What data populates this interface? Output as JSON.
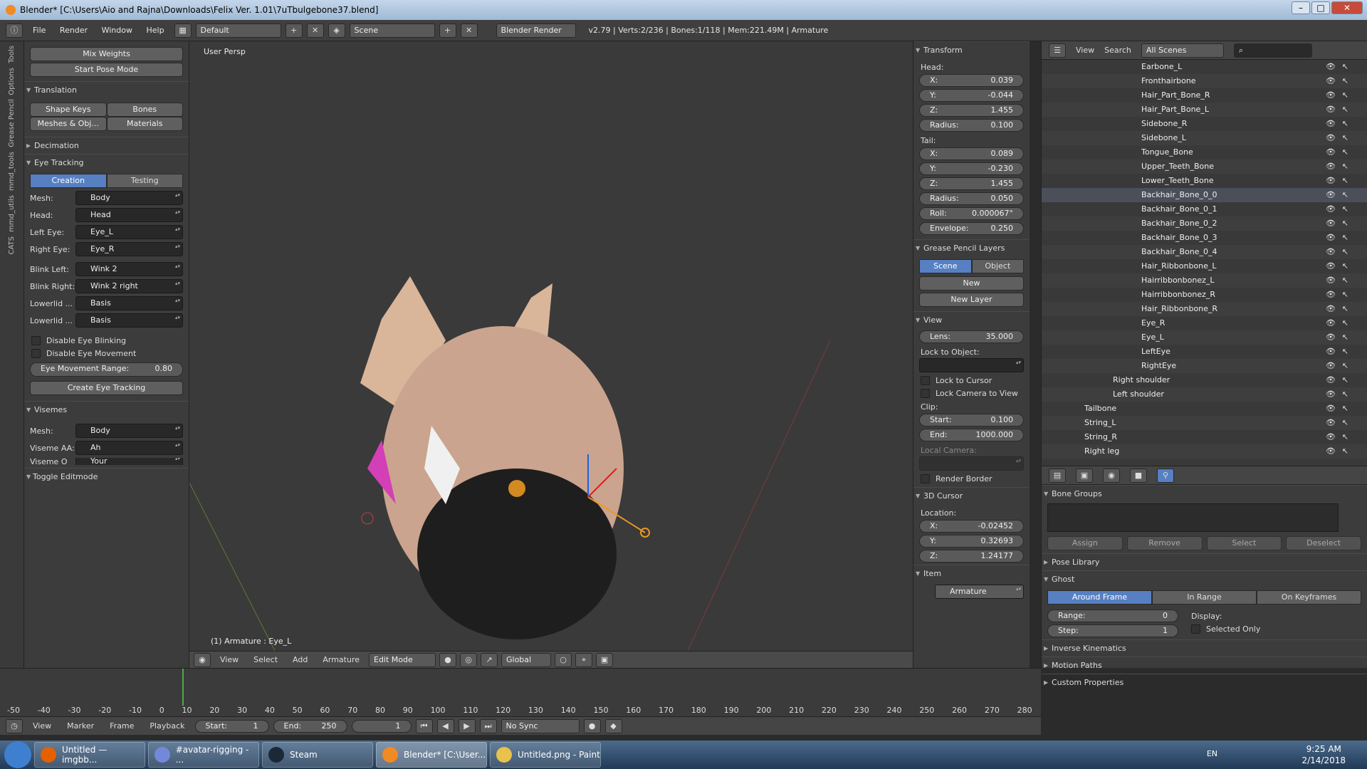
{
  "window": {
    "title": "Blender* [C:\\Users\\Aio and Rajna\\Downloads\\Felix Ver. 1.01\\7uTbulgebone37.blend]"
  },
  "topbar": {
    "menus": [
      "File",
      "Render",
      "Window",
      "Help"
    ],
    "layout": "Default",
    "scene": "Scene",
    "engine": "Blender Render",
    "stats": "v2.79 | Verts:2/236 | Bones:1/118 | Mem:221.49M | Armature"
  },
  "lefttabs": [
    "Tools",
    "Options",
    "Grease Pencil",
    "mmd_tools",
    "mmd_utils",
    "CATS"
  ],
  "toolshelf": {
    "top_buttons": [
      "Mix Weights",
      "Start Pose Mode"
    ],
    "translation": {
      "header": "Translation",
      "buttons": [
        "Shape Keys",
        "Bones",
        "Meshes & Obj...",
        "Materials"
      ]
    },
    "decimation": "Decimation",
    "eye": {
      "header": "Eye Tracking",
      "tabs": [
        "Creation",
        "Testing"
      ],
      "rows": [
        {
          "label": "Mesh:",
          "value": "Body"
        },
        {
          "label": "Head:",
          "value": "Head"
        },
        {
          "label": "Left Eye:",
          "value": "Eye_L"
        },
        {
          "label": "Right Eye:",
          "value": "Eye_R"
        },
        {
          "label": "Blink Left:",
          "value": "Wink 2"
        },
        {
          "label": "Blink Right:",
          "value": "Wink 2 right"
        },
        {
          "label": "Lowerlid ...",
          "value": "Basis"
        },
        {
          "label": "Lowerlid ...",
          "value": "Basis"
        }
      ],
      "cb1": "Disable Eye Blinking",
      "cb2": "Disable Eye Movement",
      "range_label": "Eye Movement Range:",
      "range_value": "0.80",
      "create": "Create Eye Tracking"
    },
    "visemes": {
      "header": "Visemes",
      "rows": [
        {
          "label": "Mesh:",
          "value": "Body"
        },
        {
          "label": "Viseme AA:",
          "value": "Ah"
        },
        {
          "label": "Viseme O",
          "value": "Your"
        }
      ]
    },
    "toggle": "Toggle Editmode"
  },
  "viewport": {
    "label": "User Persp",
    "status": "(1) Armature : Eye_L"
  },
  "vpbar": {
    "items": [
      "View",
      "Select",
      "Add",
      "Armature"
    ],
    "mode": "Edit Mode",
    "orient": "Global"
  },
  "npanel": {
    "transform": "Transform",
    "head": "Head:",
    "head_fields": [
      {
        "k": "X:",
        "v": "0.039"
      },
      {
        "k": "Y:",
        "v": "-0.044"
      },
      {
        "k": "Z:",
        "v": "1.455"
      },
      {
        "k": "Radius:",
        "v": "0.100"
      }
    ],
    "tail": "Tail:",
    "tail_fields": [
      {
        "k": "X:",
        "v": "0.089"
      },
      {
        "k": "Y:",
        "v": "-0.230"
      },
      {
        "k": "Z:",
        "v": "1.455"
      },
      {
        "k": "Radius:",
        "v": "0.050"
      },
      {
        "k": "Roll:",
        "v": "0.000067°"
      },
      {
        "k": "Envelope:",
        "v": "0.250"
      }
    ],
    "gp": "Grease Pencil Layers",
    "gp_tabs": [
      "Scene",
      "Object"
    ],
    "gp_new": "New",
    "gp_layer": "New Layer",
    "view": "View",
    "lens": {
      "k": "Lens:",
      "v": "35.000"
    },
    "lock_obj": "Lock to Object:",
    "lock_cursor": "Lock to Cursor",
    "lock_cam": "Lock Camera to View",
    "clip": "Clip:",
    "clip_fields": [
      {
        "k": "Start:",
        "v": "0.100"
      },
      {
        "k": "End:",
        "v": "1000.000"
      }
    ],
    "local_cam": "Local Camera:",
    "render_border": "Render Border",
    "cursor": "3D Cursor",
    "location": "Location:",
    "cursor_fields": [
      {
        "k": "X:",
        "v": "-0.02452"
      },
      {
        "k": "Y:",
        "v": "0.32693"
      },
      {
        "k": "Z:",
        "v": "1.24177"
      }
    ],
    "item": "Item",
    "item_name": "Armature"
  },
  "outliner": {
    "view": "View",
    "search": "Search",
    "scenes": "All Scenes",
    "rows": [
      {
        "name": "Earbone_L",
        "indent": 3
      },
      {
        "name": "Fronthairbone",
        "indent": 3
      },
      {
        "name": "Hair_Part_Bone_R",
        "indent": 3
      },
      {
        "name": "Hair_Part_Bone_L",
        "indent": 3
      },
      {
        "name": "Sidebone_R",
        "indent": 3
      },
      {
        "name": "Sidebone_L",
        "indent": 3
      },
      {
        "name": "Tongue_Bone",
        "indent": 3
      },
      {
        "name": "Upper_Teeth_Bone",
        "indent": 3
      },
      {
        "name": "Lower_Teeth_Bone",
        "indent": 3
      },
      {
        "name": "Backhair_Bone_0_0",
        "indent": 3
      },
      {
        "name": "Backhair_Bone_0_1",
        "indent": 3
      },
      {
        "name": "Backhair_Bone_0_2",
        "indent": 3
      },
      {
        "name": "Backhair_Bone_0_3",
        "indent": 3
      },
      {
        "name": "Backhair_Bone_0_4",
        "indent": 3
      },
      {
        "name": "Hair_Ribbonbone_L",
        "indent": 3
      },
      {
        "name": "Hairribbonbonez_L",
        "indent": 3
      },
      {
        "name": "Hairribbonbonez_R",
        "indent": 3
      },
      {
        "name": "Hair_Ribbonbone_R",
        "indent": 3
      },
      {
        "name": "Eye_R",
        "indent": 3
      },
      {
        "name": "Eye_L",
        "indent": 3
      },
      {
        "name": "LeftEye",
        "indent": 3
      },
      {
        "name": "RightEye",
        "indent": 3
      },
      {
        "name": "Right shoulder",
        "indent": 2
      },
      {
        "name": "Left shoulder",
        "indent": 2
      },
      {
        "name": "Tailbone",
        "indent": 1
      },
      {
        "name": "String_L",
        "indent": 1
      },
      {
        "name": "String_R",
        "indent": 1
      },
      {
        "name": "Right leg",
        "indent": 1
      }
    ]
  },
  "props": {
    "bone_groups": "Bone Groups",
    "bg_buttons": [
      "Assign",
      "Remove",
      "Select",
      "Deselect"
    ],
    "pose_library": "Pose Library",
    "ghost": "Ghost",
    "ghost_tabs": [
      "Around Frame",
      "In Range",
      "On Keyframes"
    ],
    "range": {
      "k": "Range:",
      "v": "0"
    },
    "step": {
      "k": "Step:",
      "v": "1"
    },
    "display": "Display:",
    "selected_only": "Selected Only",
    "ik": "Inverse Kinematics",
    "motion": "Motion Paths",
    "custom": "Custom Properties"
  },
  "timeline": {
    "ticks": [
      "-50",
      "-40",
      "-30",
      "-20",
      "-10",
      "0",
      "10",
      "20",
      "30",
      "40",
      "50",
      "60",
      "70",
      "80",
      "90",
      "100",
      "110",
      "120",
      "130",
      "140",
      "150",
      "160",
      "170",
      "180",
      "190",
      "200",
      "210",
      "220",
      "230",
      "240",
      "250",
      "260",
      "270",
      "280"
    ],
    "menus": [
      "View",
      "Marker",
      "Frame",
      "Playback"
    ],
    "start": "Start:",
    "start_v": "1",
    "end": "End:",
    "end_v": "250",
    "current": "1",
    "sync": "No Sync"
  },
  "taskbar": {
    "items": [
      "Untitled — imgbb...",
      "#avatar-rigging - ...",
      "Steam",
      "Blender* [C:\\User...",
      "Untitled.png - Paint"
    ],
    "lang": "EN",
    "time": "9:25 AM",
    "date": "2/14/2018"
  }
}
